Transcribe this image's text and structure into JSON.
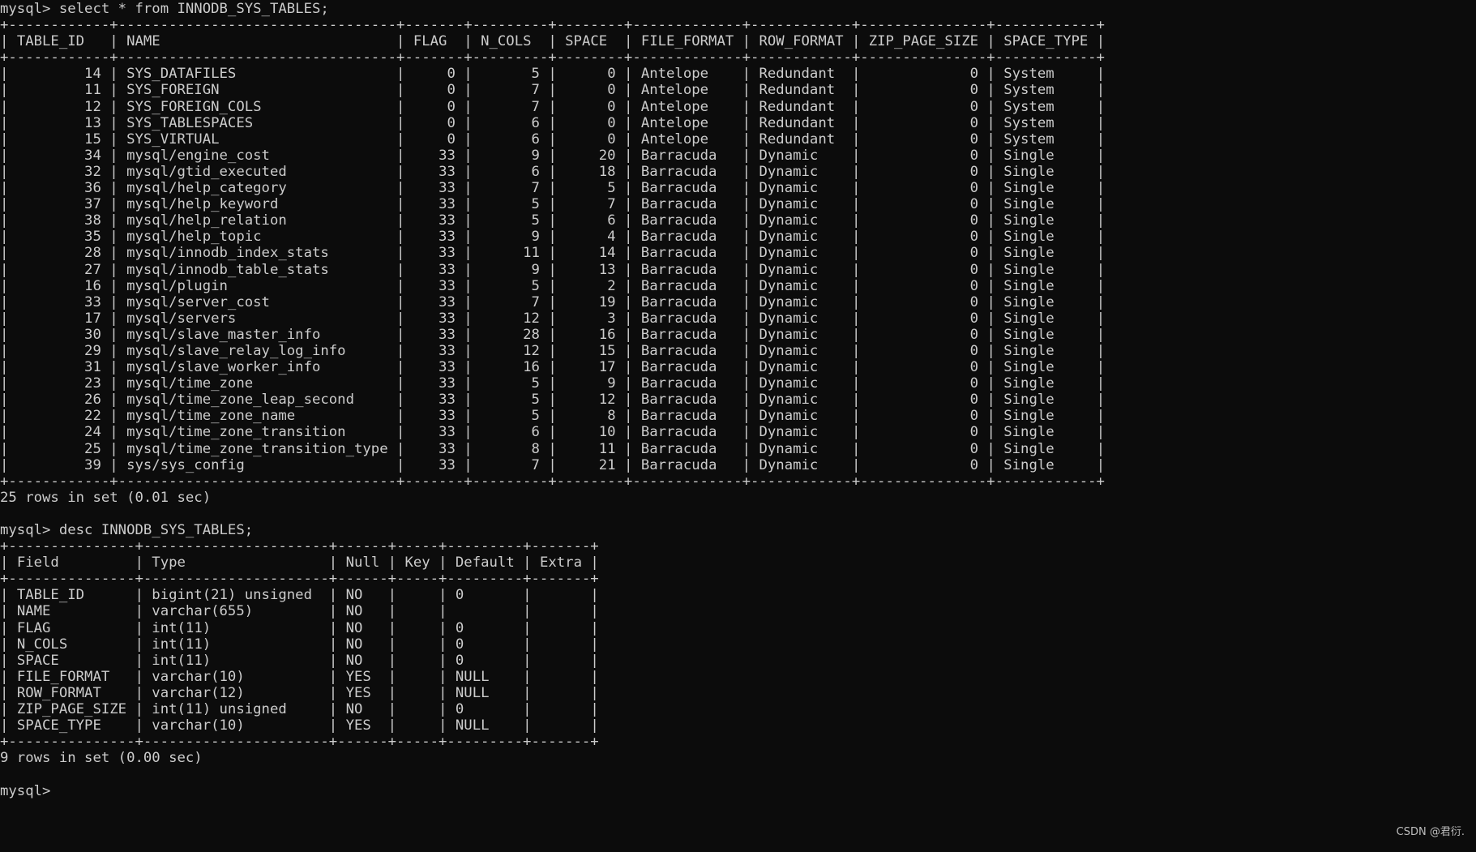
{
  "watermark": "CSDN @君衍.",
  "prompt": "mysql>",
  "blocks": [
    {
      "command": "select * from INNODB_SYS_TABLES;",
      "columns": [
        {
          "label": "TABLE_ID",
          "width": 10,
          "align": "right"
        },
        {
          "label": "NAME",
          "width": 31,
          "align": "left"
        },
        {
          "label": "FLAG",
          "width": 5,
          "align": "right"
        },
        {
          "label": "N_COLS",
          "width": 7,
          "align": "right"
        },
        {
          "label": "SPACE",
          "width": 6,
          "align": "right"
        },
        {
          "label": "FILE_FORMAT",
          "width": 11,
          "align": "left"
        },
        {
          "label": "ROW_FORMAT",
          "width": 10,
          "align": "left"
        },
        {
          "label": "ZIP_PAGE_SIZE",
          "width": 13,
          "align": "right"
        },
        {
          "label": "SPACE_TYPE",
          "width": 10,
          "align": "left"
        }
      ],
      "rows": [
        [
          "14",
          "SYS_DATAFILES",
          "0",
          "5",
          "0",
          "Antelope",
          "Redundant",
          "0",
          "System"
        ],
        [
          "11",
          "SYS_FOREIGN",
          "0",
          "7",
          "0",
          "Antelope",
          "Redundant",
          "0",
          "System"
        ],
        [
          "12",
          "SYS_FOREIGN_COLS",
          "0",
          "7",
          "0",
          "Antelope",
          "Redundant",
          "0",
          "System"
        ],
        [
          "13",
          "SYS_TABLESPACES",
          "0",
          "6",
          "0",
          "Antelope",
          "Redundant",
          "0",
          "System"
        ],
        [
          "15",
          "SYS_VIRTUAL",
          "0",
          "6",
          "0",
          "Antelope",
          "Redundant",
          "0",
          "System"
        ],
        [
          "34",
          "mysql/engine_cost",
          "33",
          "9",
          "20",
          "Barracuda",
          "Dynamic",
          "0",
          "Single"
        ],
        [
          "32",
          "mysql/gtid_executed",
          "33",
          "6",
          "18",
          "Barracuda",
          "Dynamic",
          "0",
          "Single"
        ],
        [
          "36",
          "mysql/help_category",
          "33",
          "7",
          "5",
          "Barracuda",
          "Dynamic",
          "0",
          "Single"
        ],
        [
          "37",
          "mysql/help_keyword",
          "33",
          "5",
          "7",
          "Barracuda",
          "Dynamic",
          "0",
          "Single"
        ],
        [
          "38",
          "mysql/help_relation",
          "33",
          "5",
          "6",
          "Barracuda",
          "Dynamic",
          "0",
          "Single"
        ],
        [
          "35",
          "mysql/help_topic",
          "33",
          "9",
          "4",
          "Barracuda",
          "Dynamic",
          "0",
          "Single"
        ],
        [
          "28",
          "mysql/innodb_index_stats",
          "33",
          "11",
          "14",
          "Barracuda",
          "Dynamic",
          "0",
          "Single"
        ],
        [
          "27",
          "mysql/innodb_table_stats",
          "33",
          "9",
          "13",
          "Barracuda",
          "Dynamic",
          "0",
          "Single"
        ],
        [
          "16",
          "mysql/plugin",
          "33",
          "5",
          "2",
          "Barracuda",
          "Dynamic",
          "0",
          "Single"
        ],
        [
          "33",
          "mysql/server_cost",
          "33",
          "7",
          "19",
          "Barracuda",
          "Dynamic",
          "0",
          "Single"
        ],
        [
          "17",
          "mysql/servers",
          "33",
          "12",
          "3",
          "Barracuda",
          "Dynamic",
          "0",
          "Single"
        ],
        [
          "30",
          "mysql/slave_master_info",
          "33",
          "28",
          "16",
          "Barracuda",
          "Dynamic",
          "0",
          "Single"
        ],
        [
          "29",
          "mysql/slave_relay_log_info",
          "33",
          "12",
          "15",
          "Barracuda",
          "Dynamic",
          "0",
          "Single"
        ],
        [
          "31",
          "mysql/slave_worker_info",
          "33",
          "16",
          "17",
          "Barracuda",
          "Dynamic",
          "0",
          "Single"
        ],
        [
          "23",
          "mysql/time_zone",
          "33",
          "5",
          "9",
          "Barracuda",
          "Dynamic",
          "0",
          "Single"
        ],
        [
          "26",
          "mysql/time_zone_leap_second",
          "33",
          "5",
          "12",
          "Barracuda",
          "Dynamic",
          "0",
          "Single"
        ],
        [
          "22",
          "mysql/time_zone_name",
          "33",
          "5",
          "8",
          "Barracuda",
          "Dynamic",
          "0",
          "Single"
        ],
        [
          "24",
          "mysql/time_zone_transition",
          "33",
          "6",
          "10",
          "Barracuda",
          "Dynamic",
          "0",
          "Single"
        ],
        [
          "25",
          "mysql/time_zone_transition_type",
          "33",
          "8",
          "11",
          "Barracuda",
          "Dynamic",
          "0",
          "Single"
        ],
        [
          "39",
          "sys/sys_config",
          "33",
          "7",
          "21",
          "Barracuda",
          "Dynamic",
          "0",
          "Single"
        ]
      ],
      "result": "25 rows in set (0.01 sec)"
    },
    {
      "command": "desc INNODB_SYS_TABLES;",
      "columns": [
        {
          "label": "Field",
          "width": 13,
          "align": "left"
        },
        {
          "label": "Type",
          "width": 20,
          "align": "left"
        },
        {
          "label": "Null",
          "width": 4,
          "align": "left"
        },
        {
          "label": "Key",
          "width": 3,
          "align": "left"
        },
        {
          "label": "Default",
          "width": 7,
          "align": "left"
        },
        {
          "label": "Extra",
          "width": 5,
          "align": "left"
        }
      ],
      "rows": [
        [
          "TABLE_ID",
          "bigint(21) unsigned",
          "NO",
          "",
          "0",
          ""
        ],
        [
          "NAME",
          "varchar(655)",
          "NO",
          "",
          "",
          ""
        ],
        [
          "FLAG",
          "int(11)",
          "NO",
          "",
          "0",
          ""
        ],
        [
          "N_COLS",
          "int(11)",
          "NO",
          "",
          "0",
          ""
        ],
        [
          "SPACE",
          "int(11)",
          "NO",
          "",
          "0",
          ""
        ],
        [
          "FILE_FORMAT",
          "varchar(10)",
          "YES",
          "",
          "NULL",
          ""
        ],
        [
          "ROW_FORMAT",
          "varchar(12)",
          "YES",
          "",
          "NULL",
          ""
        ],
        [
          "ZIP_PAGE_SIZE",
          "int(11) unsigned",
          "NO",
          "",
          "0",
          ""
        ],
        [
          "SPACE_TYPE",
          "varchar(10)",
          "YES",
          "",
          "NULL",
          ""
        ]
      ],
      "result": "9 rows in set (0.00 sec)"
    }
  ]
}
